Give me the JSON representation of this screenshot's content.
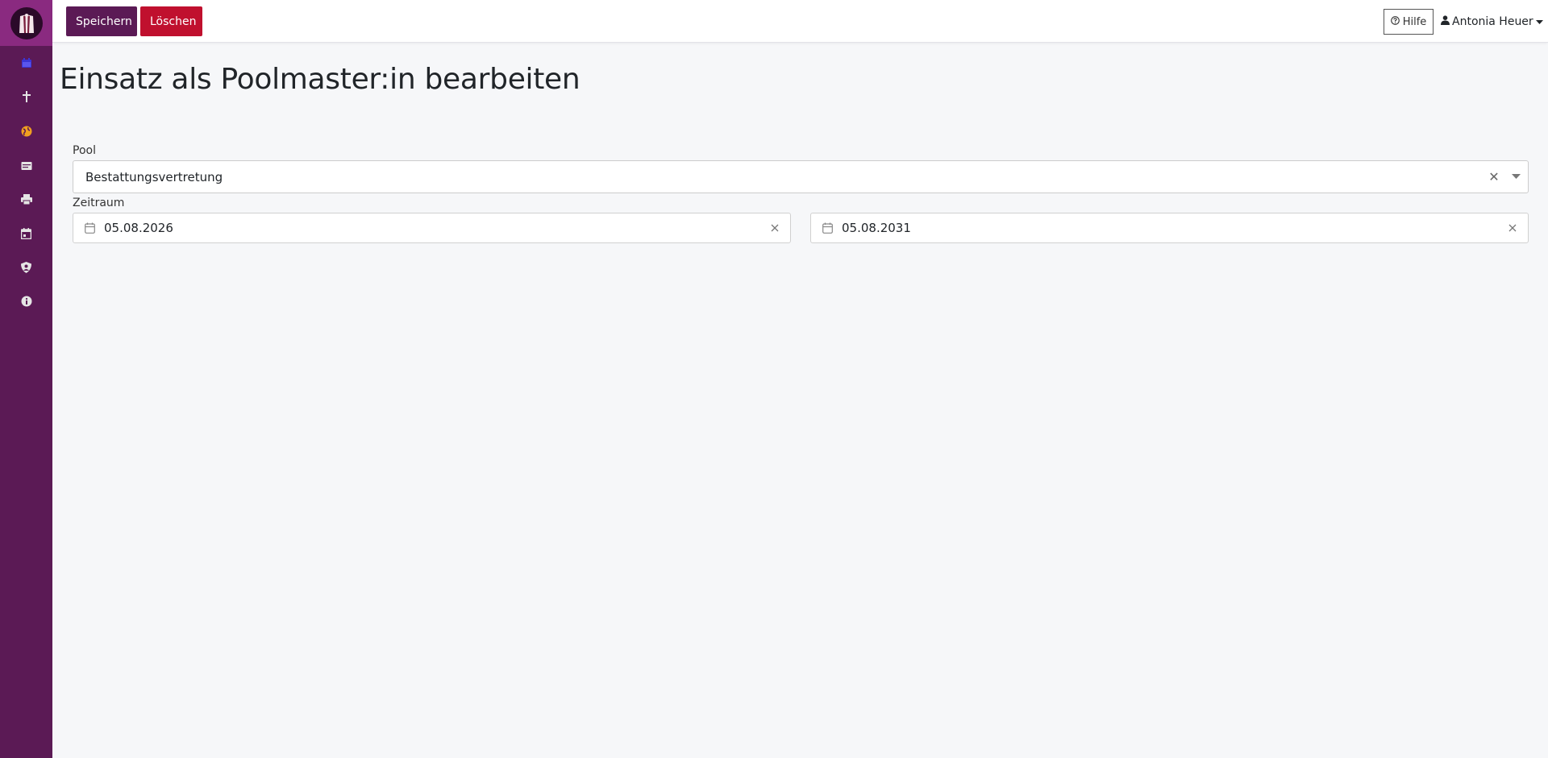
{
  "app": {
    "logo_icon": "college-robe-logo-icon",
    "accent_color": "#5b1a55",
    "danger_color": "#c0102e"
  },
  "sidebar": {
    "items": [
      {
        "icon": "calendar-icon",
        "color": "#3b35d6"
      },
      {
        "icon": "cross-icon",
        "color": "#e5e5e5"
      },
      {
        "icon": "globe-icon",
        "color": "#f0a020"
      },
      {
        "icon": "id-card-icon",
        "color": "#e5e5e5"
      },
      {
        "icon": "printer-icon",
        "color": "#e5e5e5"
      },
      {
        "icon": "calendar-day-icon",
        "color": "#e5e5e5"
      },
      {
        "icon": "user-shield-icon",
        "color": "#e5e5e5"
      },
      {
        "icon": "info-icon",
        "color": "#e5e5e5"
      }
    ]
  },
  "toolbar": {
    "save_label": "Speichern",
    "delete_label": "Löschen",
    "help_label": "Hilfe",
    "user_name": "Antonia Heuer"
  },
  "main": {
    "title": "Einsatz als Poolmaster:in bearbeiten",
    "pool": {
      "label": "Pool",
      "value": "Bestattungsvertretung"
    },
    "period": {
      "label": "Zeitraum",
      "from": "05.08.2026",
      "to": "05.08.2031"
    }
  }
}
